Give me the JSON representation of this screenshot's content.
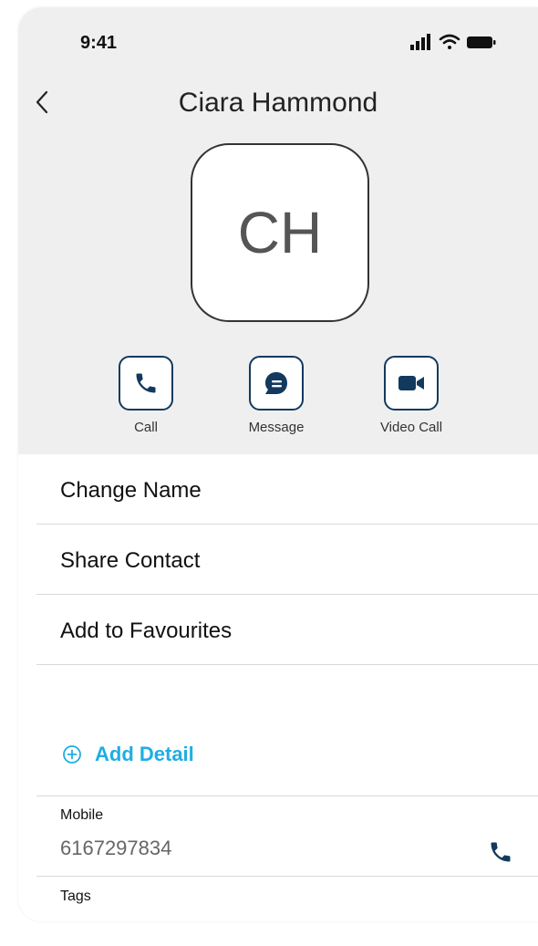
{
  "status_bar": {
    "time": "9:41"
  },
  "contact": {
    "name": "Ciara Hammond",
    "initials": "CH"
  },
  "actions": [
    {
      "label": "Call",
      "icon": "phone-icon"
    },
    {
      "label": "Message",
      "icon": "message-icon"
    },
    {
      "label": "Video Call",
      "icon": "video-camera-icon"
    }
  ],
  "menu": [
    {
      "label": "Change Name"
    },
    {
      "label": "Share Contact"
    },
    {
      "label": "Add to Favourites"
    }
  ],
  "add_detail": {
    "label": "Add Detail",
    "icon": "plus-circle-icon"
  },
  "fields": {
    "mobile": {
      "label": "Mobile",
      "value": "6167297834"
    },
    "tags": {
      "label": "Tags"
    }
  },
  "colors": {
    "accent": "#1eaee2",
    "icon_navy": "#123a5e",
    "header_bg": "#efeff0"
  }
}
